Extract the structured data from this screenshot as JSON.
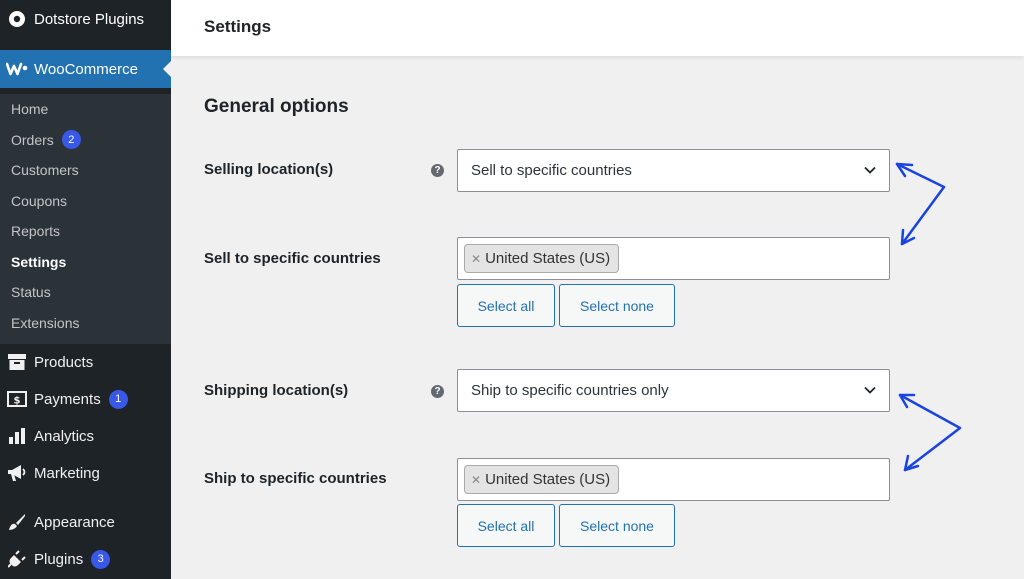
{
  "sidebar": {
    "dotstore": "Dotstore Plugins",
    "woocommerce": "WooCommerce",
    "submenu": [
      {
        "label": "Home"
      },
      {
        "label": "Orders",
        "badge": "2"
      },
      {
        "label": "Customers"
      },
      {
        "label": "Coupons"
      },
      {
        "label": "Reports"
      },
      {
        "label": "Settings",
        "active": true
      },
      {
        "label": "Status"
      },
      {
        "label": "Extensions"
      }
    ],
    "menu": [
      {
        "label": "Products",
        "icon": "archive-icon"
      },
      {
        "label": "Payments",
        "icon": "payments-icon",
        "badge": "1"
      },
      {
        "label": "Analytics",
        "icon": "bar-chart-icon"
      },
      {
        "label": "Marketing",
        "icon": "megaphone-icon"
      },
      {
        "label": "Appearance",
        "icon": "brush-icon"
      },
      {
        "label": "Plugins",
        "icon": "plug-icon",
        "badge": "3"
      }
    ]
  },
  "header": {
    "title": "Settings"
  },
  "main": {
    "section_title": "General options",
    "selling": {
      "label": "Selling location(s)",
      "value": "Sell to specific countries",
      "countries_label": "Sell to specific countries",
      "chip": "United States (US)",
      "select_all": "Select all",
      "select_none": "Select none"
    },
    "shipping": {
      "label": "Shipping location(s)",
      "value": "Ship to specific countries only",
      "countries_label": "Ship to specific countries",
      "chip": "United States (US)",
      "select_all": "Select all",
      "select_none": "Select none"
    }
  },
  "colors": {
    "sidebar_bg": "#1d2327",
    "accent": "#2271b1",
    "badge": "#3858e9",
    "arrow": "#1a44e0"
  }
}
